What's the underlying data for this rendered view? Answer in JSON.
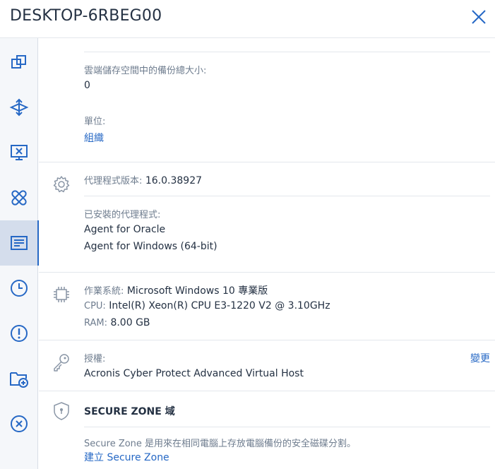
{
  "header": {
    "title": "DESKTOP-6RBEG00",
    "close_icon": "close-icon"
  },
  "sidebar": {
    "items": [
      {
        "name": "overview",
        "icon": "copy-icon"
      },
      {
        "name": "backup",
        "icon": "backup-arrows-icon"
      },
      {
        "name": "remote-desktop",
        "icon": "monitor-icon"
      },
      {
        "name": "patch",
        "icon": "bandage-icon"
      },
      {
        "name": "details",
        "icon": "document-icon",
        "active": true
      },
      {
        "name": "activities",
        "icon": "clock-icon"
      },
      {
        "name": "alerts",
        "icon": "alert-icon"
      },
      {
        "name": "add-to-group",
        "icon": "folder-add-icon"
      },
      {
        "name": "delete",
        "icon": "delete-icon"
      }
    ]
  },
  "storage": {
    "cloud_size_label": "雲端儲存空間中的備份總大小:",
    "cloud_size_value": "0",
    "unit_label": "單位:",
    "unit_value": "組織"
  },
  "agent": {
    "version_label": "代理程式版本:",
    "version_value": "16.0.38927",
    "installed_label": "已安裝的代理程式:",
    "installed": [
      "Agent for Oracle",
      "Agent for Windows (64-bit)"
    ]
  },
  "system": {
    "os_label": "作業系統:",
    "os_value": "Microsoft Windows 10 專業版",
    "cpu_label": "CPU:",
    "cpu_value": "Intel(R) Xeon(R) CPU E3-1220 V2 @ 3.10GHz",
    "ram_label": "RAM:",
    "ram_value": "8.00 GB"
  },
  "license": {
    "label": "授權:",
    "change_link": "變更",
    "value": "Acronis Cyber Protect Advanced Virtual Host"
  },
  "secure_zone": {
    "title": "SECURE ZONE 域",
    "description": "Secure Zone 是用來在相同電腦上存放電腦備份的安全磁碟分割。",
    "create_link": "建立 Secure Zone"
  },
  "colors": {
    "accent": "#2668c5",
    "icon": "#2668c5",
    "label": "#6e7c8e",
    "text": "#243143"
  }
}
